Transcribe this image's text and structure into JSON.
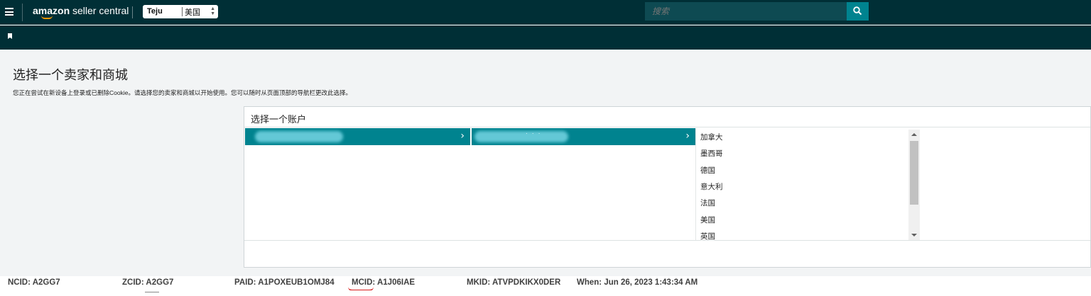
{
  "header": {
    "logo_text": "amazon",
    "logo_suffix": " seller central",
    "account_name": "Teju",
    "marketplace": "美国",
    "search_placeholder": "搜索"
  },
  "page": {
    "title": "选择一个卖家和商城",
    "subtitle": "您正在尝试在新设备上登录或已删除Cookie。请选择您的卖家和商城以开始使用。您可以随时从页面顶部的导航栏更改此选择。"
  },
  "picker": {
    "header": "选择一个账户",
    "chevron": "›",
    "marketplaces": [
      "加拿大",
      "墨西哥",
      "德国",
      "意大利",
      "法国",
      "美国",
      "英国"
    ]
  },
  "ids": {
    "ncid": "NCID: A2GG7",
    "zcid": "ZCID: A2GG7",
    "paid": "PAID: A1POXEUB1OMJ84",
    "mcid": "MCID: A1J06IAE",
    "mkid": "MKID: ATVPDKIKX0DER",
    "when": "When: Jun 26, 2023 1:43:34 AM"
  },
  "colors": {
    "topbar": "#002f36",
    "accent_teal": "#00838f",
    "logo_smile": "#ff9900",
    "annotation_red": "#d81b1b"
  }
}
